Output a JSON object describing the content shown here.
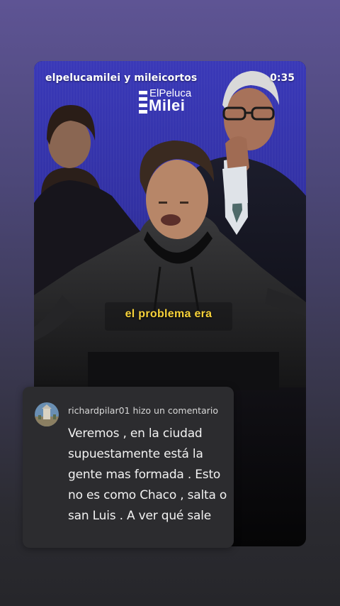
{
  "story": {
    "username": "elpelucamilei y mileicortos",
    "timer": "0:35",
    "logo": {
      "top_text": "ElPeluca",
      "bottom_text": "Milei"
    },
    "caption": "el problema era"
  },
  "comment": {
    "header": "richardpilar01 hizo un comentario",
    "text": "Veremos , en la ciudad supuestamente está la gente mas formada . Esto no es como Chaco , salta o san Luis . A ver qué sale"
  },
  "colors": {
    "background_top": "#5e5494",
    "background_bottom": "#26262a",
    "video_blue": "#3231a3",
    "caption_yellow": "#f7d23a",
    "comment_card": "#2c2c2f"
  }
}
